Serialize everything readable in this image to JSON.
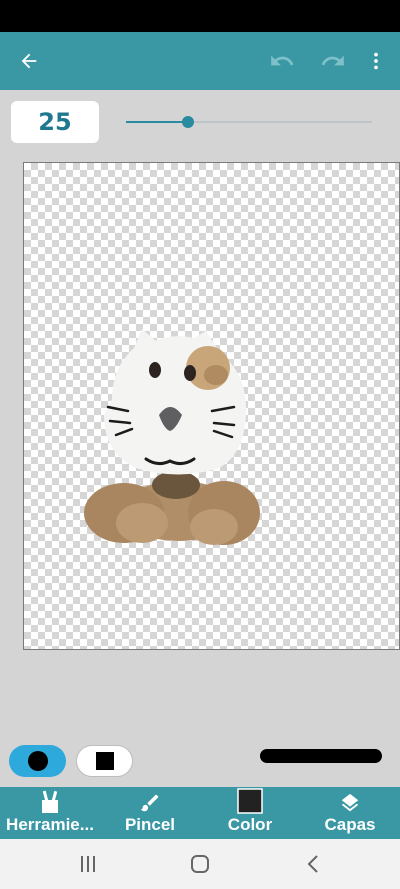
{
  "brush": {
    "size_value": "25",
    "size_slider_fraction": 0.25
  },
  "app_bar": {
    "back_icon": "arrow-left-icon",
    "undo_icon": "undo-icon",
    "redo_icon": "redo-icon",
    "menu_icon": "more-vert-icon"
  },
  "tabs": [
    {
      "label": "Herramie...",
      "icon": "tools-icon"
    },
    {
      "label": "Pincel",
      "icon": "brush-icon"
    },
    {
      "label": "Color",
      "icon": "color-swatch-icon"
    },
    {
      "label": "Capas",
      "icon": "layers-icon"
    }
  ],
  "colors": {
    "accent": "#3a98a5",
    "mode_active": "#2ea9dc",
    "swatch": "#222222"
  },
  "nav": {
    "recents_icon": "recents-icon",
    "home_icon": "home-icon",
    "back_icon": "nav-back-icon"
  }
}
